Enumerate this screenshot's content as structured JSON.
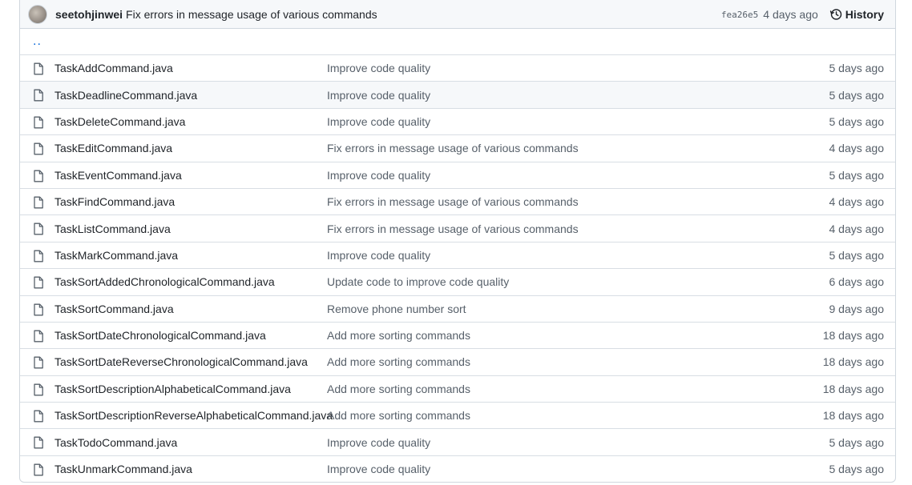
{
  "commit": {
    "author": "seetohjinwei",
    "message": "Fix errors in message usage of various commands",
    "sha": "fea26e5",
    "age": "4 days ago",
    "history_label": "History"
  },
  "parent_link": "..",
  "files": [
    {
      "name": "TaskAddCommand.java",
      "message": "Improve code quality",
      "age": "5 days ago"
    },
    {
      "name": "TaskDeadlineCommand.java",
      "message": "Improve code quality",
      "age": "5 days ago"
    },
    {
      "name": "TaskDeleteCommand.java",
      "message": "Improve code quality",
      "age": "5 days ago"
    },
    {
      "name": "TaskEditCommand.java",
      "message": "Fix errors in message usage of various commands",
      "age": "4 days ago"
    },
    {
      "name": "TaskEventCommand.java",
      "message": "Improve code quality",
      "age": "5 days ago"
    },
    {
      "name": "TaskFindCommand.java",
      "message": "Fix errors in message usage of various commands",
      "age": "4 days ago"
    },
    {
      "name": "TaskListCommand.java",
      "message": "Fix errors in message usage of various commands",
      "age": "4 days ago"
    },
    {
      "name": "TaskMarkCommand.java",
      "message": "Improve code quality",
      "age": "5 days ago"
    },
    {
      "name": "TaskSortAddedChronologicalCommand.java",
      "message": "Update code to improve code quality",
      "age": "6 days ago"
    },
    {
      "name": "TaskSortCommand.java",
      "message": "Remove phone number sort",
      "age": "9 days ago"
    },
    {
      "name": "TaskSortDateChronologicalCommand.java",
      "message": "Add more sorting commands",
      "age": "18 days ago"
    },
    {
      "name": "TaskSortDateReverseChronologicalCommand.java",
      "message": "Add more sorting commands",
      "age": "18 days ago"
    },
    {
      "name": "TaskSortDescriptionAlphabeticalCommand.java",
      "message": "Add more sorting commands",
      "age": "18 days ago"
    },
    {
      "name": "TaskSortDescriptionReverseAlphabeticalCommand.java",
      "message": "Add more sorting commands",
      "age": "18 days ago"
    },
    {
      "name": "TaskTodoCommand.java",
      "message": "Improve code quality",
      "age": "5 days ago"
    },
    {
      "name": "TaskUnmarkCommand.java",
      "message": "Improve code quality",
      "age": "5 days ago"
    }
  ]
}
